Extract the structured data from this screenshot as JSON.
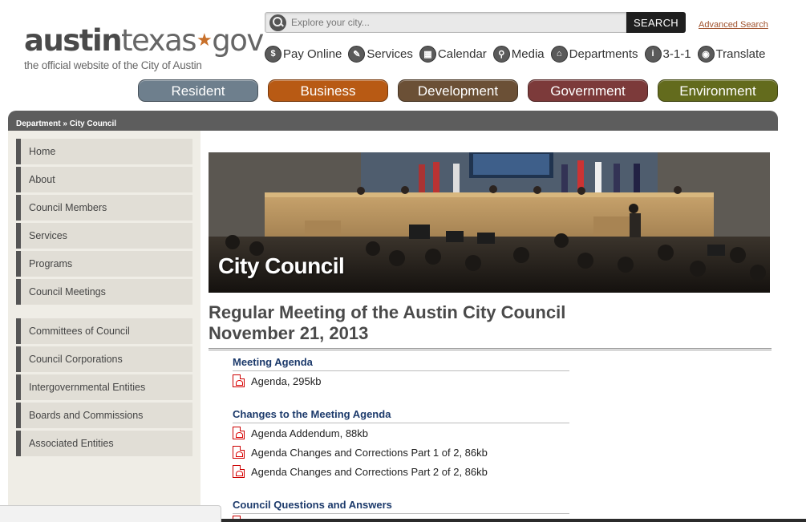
{
  "logo": {
    "part1": "austin",
    "part2": "texas",
    "star": "★",
    "part3": "gov",
    "tagline": "the official website of the City of Austin"
  },
  "search": {
    "placeholder": "Explore your city...",
    "button_label": "SEARCH",
    "advanced_label": "Advanced Search"
  },
  "quicklinks": [
    {
      "label": "Pay Online",
      "icon": "dollar-icon",
      "glyph": "$"
    },
    {
      "label": "Services",
      "icon": "checklist-icon",
      "glyph": "✎"
    },
    {
      "label": "Calendar",
      "icon": "calendar-icon",
      "glyph": "▦"
    },
    {
      "label": "Media",
      "icon": "antenna-icon",
      "glyph": "⚲"
    },
    {
      "label": "Departments",
      "icon": "building-icon",
      "glyph": "⌂"
    },
    {
      "label": "3-1-1",
      "icon": "info-icon",
      "glyph": "i"
    },
    {
      "label": "Translate",
      "icon": "globe-icon",
      "glyph": "◉"
    }
  ],
  "tabs": [
    {
      "label": "Resident",
      "color": "#6e7f8d"
    },
    {
      "label": "Business",
      "color": "#b85a14"
    },
    {
      "label": "Development",
      "color": "#6b5036"
    },
    {
      "label": "Government",
      "color": "#7c3a3a"
    },
    {
      "label": "Environment",
      "color": "#636b1d"
    }
  ],
  "breadcrumb": {
    "parent": "Department",
    "separator": " » ",
    "current": "City Council"
  },
  "sidebar": {
    "group1": [
      "Home",
      "About",
      "Council Members",
      "Services",
      "Programs",
      "Council Meetings"
    ],
    "group2": [
      "Committees of Council",
      "Council Corporations",
      "Intergovernmental Entities",
      "Boards and Commissions",
      "Associated Entities"
    ]
  },
  "hero": {
    "title": "City Council"
  },
  "page": {
    "title_line1": "Regular Meeting of the Austin City Council",
    "title_line2": "November 21, 2013"
  },
  "sections": [
    {
      "heading": "Meeting Agenda",
      "docs": [
        "Agenda,  295kb"
      ]
    },
    {
      "heading": "Changes to the Meeting Agenda",
      "docs": [
        "Agenda Addendum,  88kb",
        "Agenda Changes and Corrections Part 1 of 2,  86kb",
        "Agenda Changes and Corrections Part 2 of 2,  86kb"
      ]
    },
    {
      "heading": "Council Questions and Answers",
      "docs": []
    }
  ]
}
